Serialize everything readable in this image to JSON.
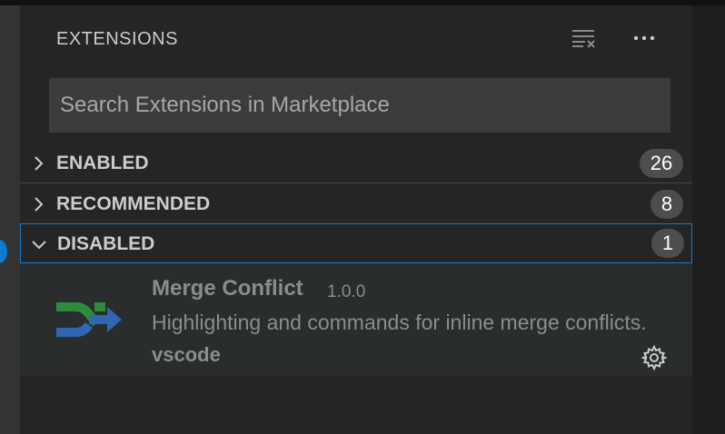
{
  "panel": {
    "title": "EXTENSIONS",
    "actions": [
      "clear-extensions-icon",
      "more-actions-icon"
    ]
  },
  "search": {
    "placeholder": "Search Extensions in Marketplace",
    "value": ""
  },
  "sections": {
    "enabled": {
      "label": "ENABLED",
      "count": "26",
      "expanded": false
    },
    "recommended": {
      "label": "RECOMMENDED",
      "count": "8",
      "expanded": false
    },
    "disabled": {
      "label": "DISABLED",
      "count": "1",
      "expanded": true
    }
  },
  "extension": {
    "name": "Merge Conflict",
    "version": "1.0.0",
    "description": "Highlighting and commands for inline merge conflicts.",
    "publisher": "vscode",
    "icon": "merge-conflict-icon"
  },
  "colors": {
    "accent_focus": "#0e7ad0",
    "badge_bg": "#4d4d4d",
    "icon_green": "#2e8b3c",
    "icon_blue": "#2f67b2"
  }
}
